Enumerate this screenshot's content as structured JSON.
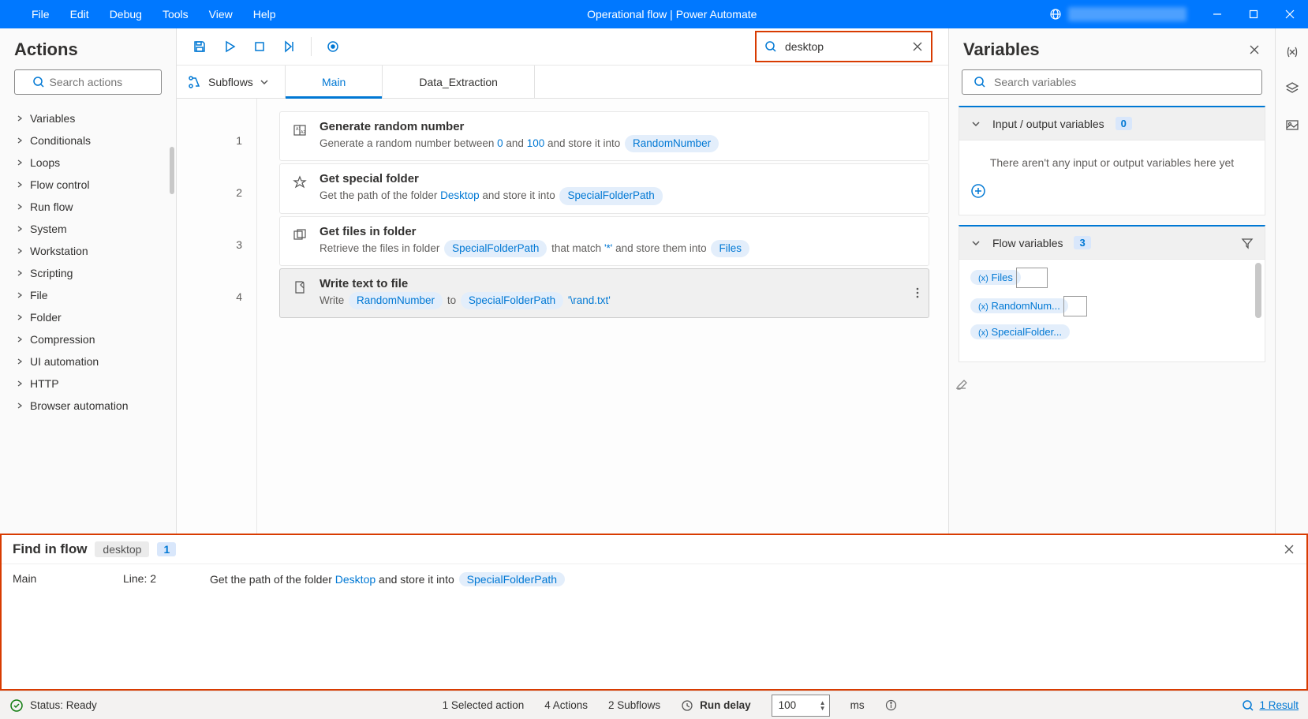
{
  "titlebar": {
    "title": "Operational flow | Power Automate",
    "menu": [
      "File",
      "Edit",
      "Debug",
      "Tools",
      "View",
      "Help"
    ]
  },
  "actions": {
    "title": "Actions",
    "search_placeholder": "Search actions",
    "categories": [
      "Variables",
      "Conditionals",
      "Loops",
      "Flow control",
      "Run flow",
      "System",
      "Workstation",
      "Scripting",
      "File",
      "Folder",
      "Compression",
      "UI automation",
      "HTTP",
      "Browser automation"
    ]
  },
  "toolbar": {
    "search_value": "desktop"
  },
  "tabs": {
    "subflows_label": "Subflows",
    "items": [
      "Main",
      "Data_Extraction"
    ],
    "active": 0
  },
  "steps": [
    {
      "title": "Generate random number",
      "desc_parts": [
        "Generate a random number between ",
        {
          "t": "token",
          "v": "0"
        },
        " and ",
        {
          "t": "token",
          "v": "100"
        },
        " and store it into ",
        {
          "t": "pill",
          "v": "RandomNumber"
        }
      ]
    },
    {
      "title": "Get special folder",
      "desc_parts": [
        "Get the path of the folder ",
        {
          "t": "token",
          "v": "Desktop"
        },
        " and store it into ",
        {
          "t": "pill",
          "v": "SpecialFolderPath"
        }
      ]
    },
    {
      "title": "Get files in folder",
      "desc_parts": [
        "Retrieve the files in folder ",
        {
          "t": "pill",
          "v": "SpecialFolderPath"
        },
        " that match ",
        {
          "t": "token",
          "v": "'*'"
        },
        " and store them into ",
        {
          "t": "pill",
          "v": "Files"
        }
      ]
    },
    {
      "title": "Write text to file",
      "desc_parts": [
        "Write ",
        {
          "t": "pill",
          "v": "RandomNumber"
        },
        " to ",
        {
          "t": "pill",
          "v": "SpecialFolderPath"
        },
        " ",
        {
          "t": "token",
          "v": "'\\rand.txt'"
        }
      ],
      "selected": true
    }
  ],
  "variables": {
    "title": "Variables",
    "search_placeholder": "Search variables",
    "io_section": {
      "label": "Input / output variables",
      "count": "0",
      "empty_text": "There aren't any input or output variables here yet"
    },
    "flow_section": {
      "label": "Flow variables",
      "count": "3",
      "items": [
        "Files",
        "RandomNum...",
        "SpecialFolder..."
      ]
    }
  },
  "find": {
    "title": "Find in flow",
    "term": "desktop",
    "count": "1",
    "result": {
      "subflow": "Main",
      "line": "Line: 2",
      "desc_parts": [
        "Get the path of the folder ",
        {
          "t": "token",
          "v": "Desktop"
        },
        " and store it into ",
        {
          "t": "pill",
          "v": "SpecialFolderPath"
        }
      ]
    }
  },
  "status": {
    "ready": "Status: Ready",
    "selected": "1 Selected action",
    "actions": "4 Actions",
    "subflows": "2 Subflows",
    "delay_label": "Run delay",
    "delay_value": "100",
    "delay_unit": "ms",
    "result": "1 Result"
  }
}
